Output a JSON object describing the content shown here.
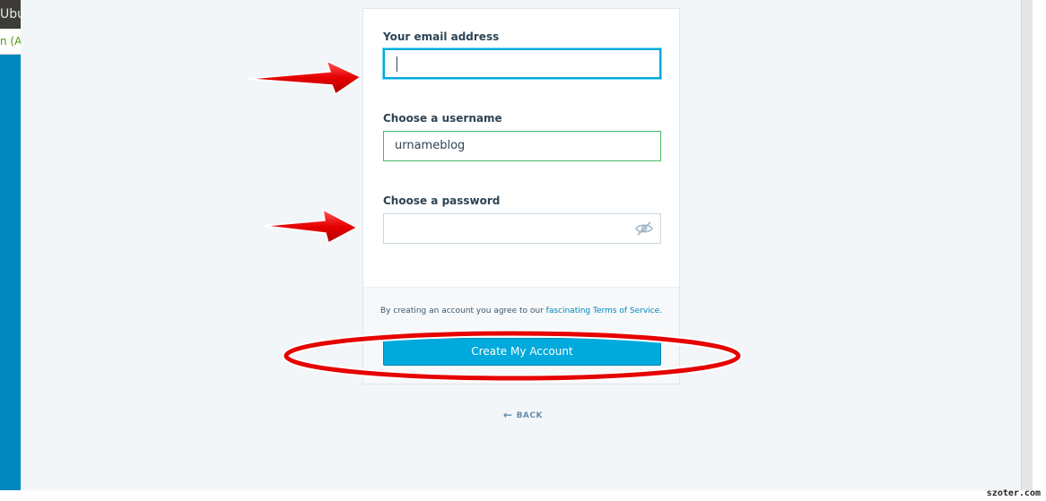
{
  "browser": {
    "tab_fragment": "Ubu",
    "line_fragment": "n (Au"
  },
  "form": {
    "email": {
      "label": "Your email address",
      "value": ""
    },
    "username": {
      "label": "Choose a username",
      "value": "urnameblog"
    },
    "password": {
      "label": "Choose a password",
      "value": ""
    },
    "tos": {
      "prefix": "By creating an account you agree to our ",
      "link": "fascinating Terms of Service",
      "suffix": "."
    },
    "submit_label": "Create My Account",
    "back_label": "BACK"
  },
  "watermark": "szoter.com",
  "colors": {
    "accent": "#00aadc",
    "valid": "#4ab866",
    "annotation": "#e60000"
  },
  "icons": {
    "password_toggle": "eye-slash-icon",
    "back": "arrow-left-icon"
  }
}
